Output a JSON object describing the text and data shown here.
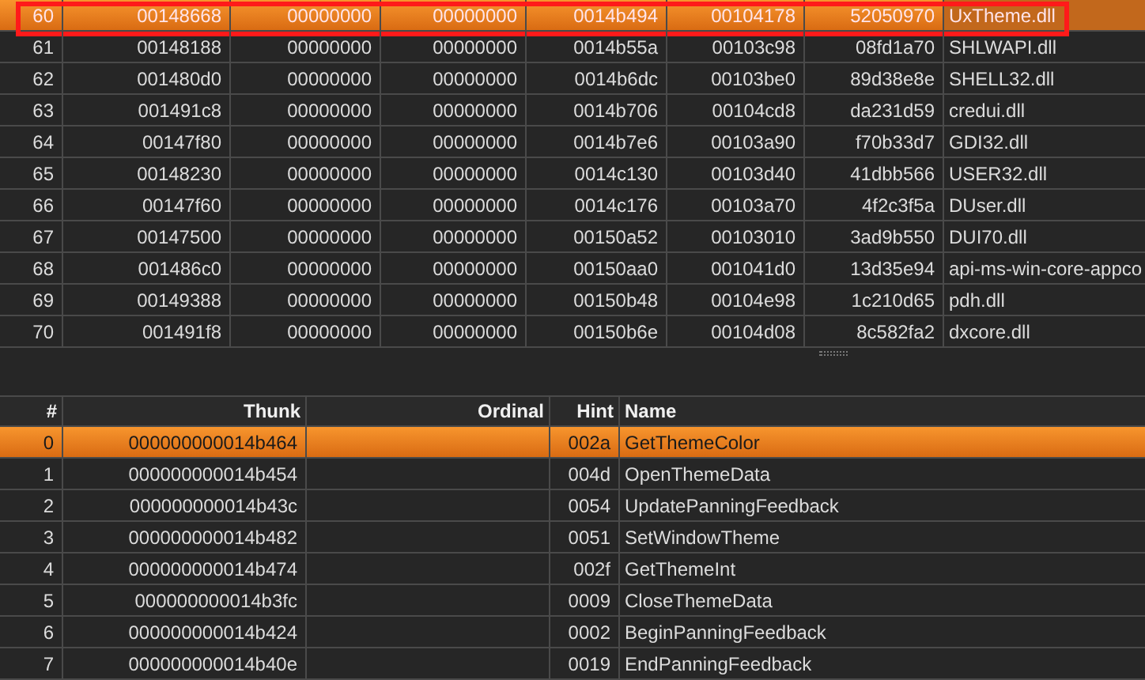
{
  "modules_table": {
    "rows": [
      {
        "index": "60",
        "column_2": "00148668",
        "column_3": "00000000",
        "column_4": "00000000",
        "column_5": "0014b494",
        "column_6": "00104178",
        "column_7": "52050970",
        "name": "UxTheme.dll",
        "selected": true,
        "outlined": true
      },
      {
        "index": "61",
        "column_2": "00148188",
        "column_3": "00000000",
        "column_4": "00000000",
        "column_5": "0014b55a",
        "column_6": "00103c98",
        "column_7": "08fd1a70",
        "name": "SHLWAPI.dll",
        "selected": false,
        "outlined": false
      },
      {
        "index": "62",
        "column_2": "001480d0",
        "column_3": "00000000",
        "column_4": "00000000",
        "column_5": "0014b6dc",
        "column_6": "00103be0",
        "column_7": "89d38e8e",
        "name": "SHELL32.dll",
        "selected": false,
        "outlined": false
      },
      {
        "index": "63",
        "column_2": "001491c8",
        "column_3": "00000000",
        "column_4": "00000000",
        "column_5": "0014b706",
        "column_6": "00104cd8",
        "column_7": "da231d59",
        "name": "credui.dll",
        "selected": false,
        "outlined": false
      },
      {
        "index": "64",
        "column_2": "00147f80",
        "column_3": "00000000",
        "column_4": "00000000",
        "column_5": "0014b7e6",
        "column_6": "00103a90",
        "column_7": "f70b33d7",
        "name": "GDI32.dll",
        "selected": false,
        "outlined": false
      },
      {
        "index": "65",
        "column_2": "00148230",
        "column_3": "00000000",
        "column_4": "00000000",
        "column_5": "0014c130",
        "column_6": "00103d40",
        "column_7": "41dbb566",
        "name": "USER32.dll",
        "selected": false,
        "outlined": false
      },
      {
        "index": "66",
        "column_2": "00147f60",
        "column_3": "00000000",
        "column_4": "00000000",
        "column_5": "0014c176",
        "column_6": "00103a70",
        "column_7": "4f2c3f5a",
        "name": "DUser.dll",
        "selected": false,
        "outlined": false
      },
      {
        "index": "67",
        "column_2": "00147500",
        "column_3": "00000000",
        "column_4": "00000000",
        "column_5": "00150a52",
        "column_6": "00103010",
        "column_7": "3ad9b550",
        "name": "DUI70.dll",
        "selected": false,
        "outlined": false
      },
      {
        "index": "68",
        "column_2": "001486c0",
        "column_3": "00000000",
        "column_4": "00000000",
        "column_5": "00150aa0",
        "column_6": "001041d0",
        "column_7": "13d35e94",
        "name": "api-ms-win-core-appco",
        "selected": false,
        "outlined": false
      },
      {
        "index": "69",
        "column_2": "00149388",
        "column_3": "00000000",
        "column_4": "00000000",
        "column_5": "00150b48",
        "column_6": "00104e98",
        "column_7": "1c210d65",
        "name": "pdh.dll",
        "selected": false,
        "outlined": false
      },
      {
        "index": "70",
        "column_2": "001491f8",
        "column_3": "00000000",
        "column_4": "00000000",
        "column_5": "00150b6e",
        "column_6": "00104d08",
        "column_7": "8c582fa2",
        "name": "dxcore.dll",
        "selected": false,
        "outlined": false
      }
    ]
  },
  "imports_table": {
    "columns": [
      "#",
      "Thunk",
      "Ordinal",
      "Hint",
      "Name"
    ],
    "rows": [
      {
        "index": "0",
        "thunk": "000000000014b464",
        "hint": "002a",
        "name": "GetThemeColor",
        "selected": true
      },
      {
        "index": "1",
        "thunk": "000000000014b454",
        "hint": "004d",
        "name": "OpenThemeData",
        "selected": false
      },
      {
        "index": "2",
        "thunk": "000000000014b43c",
        "hint": "0054",
        "name": "UpdatePanningFeedback",
        "selected": false
      },
      {
        "index": "3",
        "thunk": "000000000014b482",
        "hint": "0051",
        "name": "SetWindowTheme",
        "selected": false
      },
      {
        "index": "4",
        "thunk": "000000000014b474",
        "hint": "002f",
        "name": "GetThemeInt",
        "selected": false
      },
      {
        "index": "5",
        "thunk": "000000000014b3fc",
        "hint": "0009",
        "name": "CloseThemeData",
        "selected": false
      },
      {
        "index": "6",
        "thunk": "000000000014b424",
        "hint": "0002",
        "name": "BeginPanningFeedback",
        "selected": false
      },
      {
        "index": "7",
        "thunk": "000000000014b40e",
        "hint": "0019",
        "name": "EndPanningFeedback",
        "selected": false
      }
    ]
  }
}
